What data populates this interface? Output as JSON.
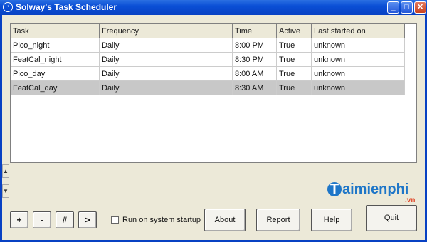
{
  "window": {
    "title": "Solway's Task Scheduler",
    "minimize": "_",
    "maximize": "□",
    "close": "✕"
  },
  "table": {
    "columns": [
      "Task",
      "Frequency",
      "Time",
      "Active",
      "Last started on"
    ],
    "rows": [
      [
        "Pico_night",
        "Daily",
        "8:00 PM",
        "True",
        "unknown"
      ],
      [
        "FeatCal_night",
        "Daily",
        "8:30 PM",
        "True",
        "unknown"
      ],
      [
        "Pico_day",
        "Daily",
        "8:00 AM",
        "True",
        "unknown"
      ],
      [
        "FeatCal_day",
        "Daily",
        "8:30 AM",
        "True",
        "unknown"
      ]
    ],
    "selected_row": 3
  },
  "scroll": {
    "up": "▲",
    "down": "▼"
  },
  "buttons": {
    "add": "+",
    "remove": "-",
    "number": "#",
    "next": ">",
    "about": "About",
    "report": "Report",
    "help": "Help",
    "quit": "Quit"
  },
  "startup": {
    "label": "Run on system startup",
    "checked": false
  },
  "watermark": {
    "brand": "aimienphi",
    "initial": "T",
    "suffix": ".vn"
  },
  "colors": {
    "titlebar": "#0a4fd6",
    "selected_row": "#c8c8c8"
  }
}
